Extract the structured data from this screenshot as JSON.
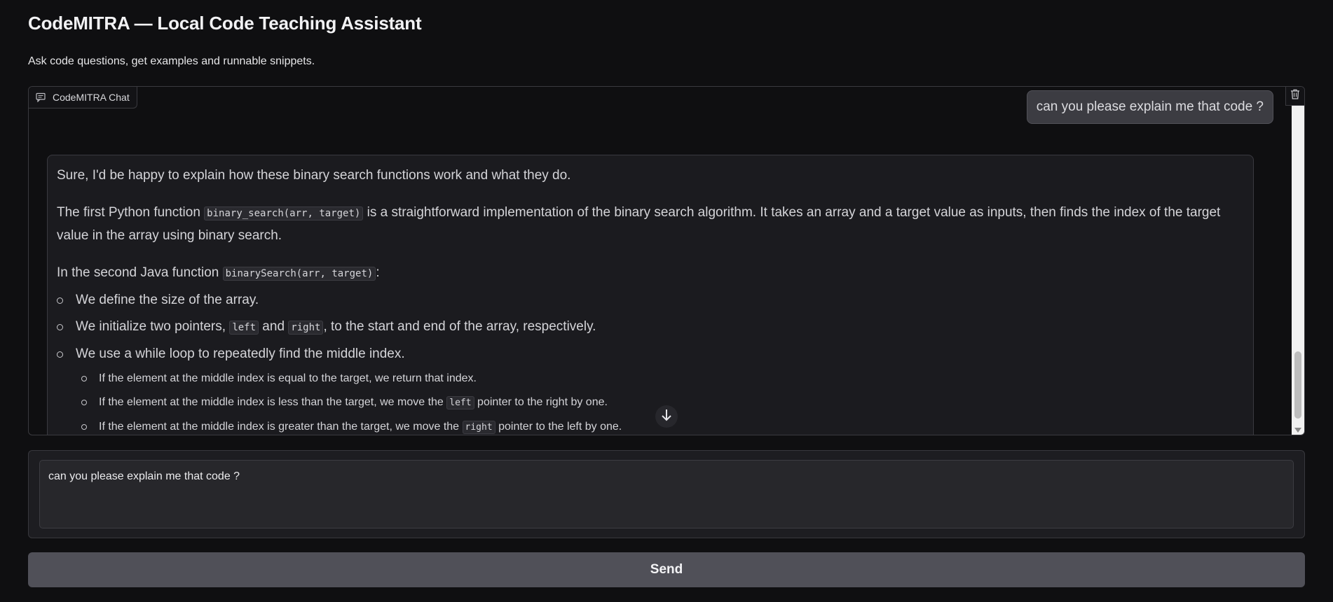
{
  "app": {
    "title": "CodeMITRA — Local Code Teaching Assistant",
    "subtitle": "Ask code questions, get examples and runnable snippets."
  },
  "chat": {
    "label": "CodeMITRA Chat",
    "label_icon": "chat-icon",
    "clear_icon": "trash-icon",
    "user_message": "can you please explain me that code ?",
    "bot": {
      "intro": "Sure, I'd be happy to explain how these binary search functions work and what they do.",
      "p2_before": "The first Python function ",
      "p2_code": "binary_search(arr, target)",
      "p2_after": " is a straightforward implementation of the binary search algorithm. It takes an array and a target value as inputs, then finds the index of the target value in the array using binary search.",
      "p3_before": "In the second Java function ",
      "p3_code": "binarySearch(arr, target)",
      "p3_after": ":",
      "bullets": {
        "b1": "We define the size of the array.",
        "b2_before": "We initialize two pointers, ",
        "b2_code1": "left",
        "b2_mid": " and ",
        "b2_code2": "right",
        "b2_after": ", to the start and end of the array, respectively.",
        "b3": "We use a while loop to repeatedly find the middle index.",
        "sub1": "If the element at the middle index is equal to the target, we return that index.",
        "sub2_before": "If the element at the middle index is less than the target, we move the ",
        "sub2_code": "left",
        "sub2_after": " pointer to the right by one.",
        "sub3_before": "If the element at the middle index is greater than the target, we move the ",
        "sub3_code": "right",
        "sub3_after": " pointer to the left by one."
      }
    },
    "scroll_down_icon": "arrow-down-icon"
  },
  "input": {
    "value": "can you please explain me that code ?"
  },
  "send_label": "Send"
}
